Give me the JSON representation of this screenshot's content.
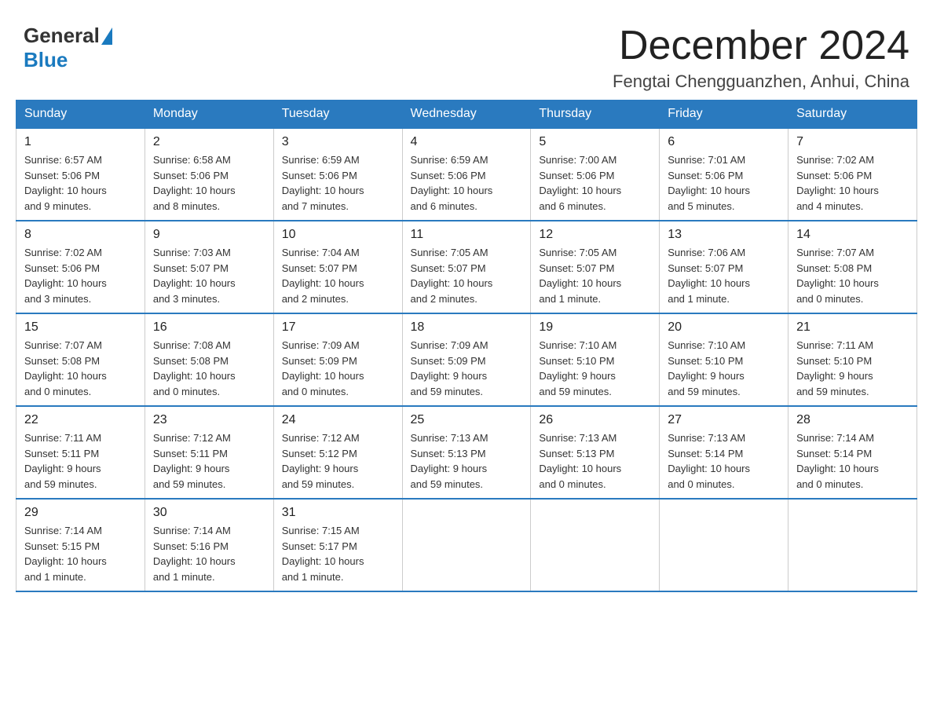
{
  "header": {
    "logo_general": "General",
    "logo_blue": "Blue",
    "month_title": "December 2024",
    "location": "Fengtai Chengguanzhen, Anhui, China"
  },
  "days_of_week": [
    "Sunday",
    "Monday",
    "Tuesday",
    "Wednesday",
    "Thursday",
    "Friday",
    "Saturday"
  ],
  "weeks": [
    [
      {
        "day": "1",
        "info": "Sunrise: 6:57 AM\nSunset: 5:06 PM\nDaylight: 10 hours\nand 9 minutes."
      },
      {
        "day": "2",
        "info": "Sunrise: 6:58 AM\nSunset: 5:06 PM\nDaylight: 10 hours\nand 8 minutes."
      },
      {
        "day": "3",
        "info": "Sunrise: 6:59 AM\nSunset: 5:06 PM\nDaylight: 10 hours\nand 7 minutes."
      },
      {
        "day": "4",
        "info": "Sunrise: 6:59 AM\nSunset: 5:06 PM\nDaylight: 10 hours\nand 6 minutes."
      },
      {
        "day": "5",
        "info": "Sunrise: 7:00 AM\nSunset: 5:06 PM\nDaylight: 10 hours\nand 6 minutes."
      },
      {
        "day": "6",
        "info": "Sunrise: 7:01 AM\nSunset: 5:06 PM\nDaylight: 10 hours\nand 5 minutes."
      },
      {
        "day": "7",
        "info": "Sunrise: 7:02 AM\nSunset: 5:06 PM\nDaylight: 10 hours\nand 4 minutes."
      }
    ],
    [
      {
        "day": "8",
        "info": "Sunrise: 7:02 AM\nSunset: 5:06 PM\nDaylight: 10 hours\nand 3 minutes."
      },
      {
        "day": "9",
        "info": "Sunrise: 7:03 AM\nSunset: 5:07 PM\nDaylight: 10 hours\nand 3 minutes."
      },
      {
        "day": "10",
        "info": "Sunrise: 7:04 AM\nSunset: 5:07 PM\nDaylight: 10 hours\nand 2 minutes."
      },
      {
        "day": "11",
        "info": "Sunrise: 7:05 AM\nSunset: 5:07 PM\nDaylight: 10 hours\nand 2 minutes."
      },
      {
        "day": "12",
        "info": "Sunrise: 7:05 AM\nSunset: 5:07 PM\nDaylight: 10 hours\nand 1 minute."
      },
      {
        "day": "13",
        "info": "Sunrise: 7:06 AM\nSunset: 5:07 PM\nDaylight: 10 hours\nand 1 minute."
      },
      {
        "day": "14",
        "info": "Sunrise: 7:07 AM\nSunset: 5:08 PM\nDaylight: 10 hours\nand 0 minutes."
      }
    ],
    [
      {
        "day": "15",
        "info": "Sunrise: 7:07 AM\nSunset: 5:08 PM\nDaylight: 10 hours\nand 0 minutes."
      },
      {
        "day": "16",
        "info": "Sunrise: 7:08 AM\nSunset: 5:08 PM\nDaylight: 10 hours\nand 0 minutes."
      },
      {
        "day": "17",
        "info": "Sunrise: 7:09 AM\nSunset: 5:09 PM\nDaylight: 10 hours\nand 0 minutes."
      },
      {
        "day": "18",
        "info": "Sunrise: 7:09 AM\nSunset: 5:09 PM\nDaylight: 9 hours\nand 59 minutes."
      },
      {
        "day": "19",
        "info": "Sunrise: 7:10 AM\nSunset: 5:10 PM\nDaylight: 9 hours\nand 59 minutes."
      },
      {
        "day": "20",
        "info": "Sunrise: 7:10 AM\nSunset: 5:10 PM\nDaylight: 9 hours\nand 59 minutes."
      },
      {
        "day": "21",
        "info": "Sunrise: 7:11 AM\nSunset: 5:10 PM\nDaylight: 9 hours\nand 59 minutes."
      }
    ],
    [
      {
        "day": "22",
        "info": "Sunrise: 7:11 AM\nSunset: 5:11 PM\nDaylight: 9 hours\nand 59 minutes."
      },
      {
        "day": "23",
        "info": "Sunrise: 7:12 AM\nSunset: 5:11 PM\nDaylight: 9 hours\nand 59 minutes."
      },
      {
        "day": "24",
        "info": "Sunrise: 7:12 AM\nSunset: 5:12 PM\nDaylight: 9 hours\nand 59 minutes."
      },
      {
        "day": "25",
        "info": "Sunrise: 7:13 AM\nSunset: 5:13 PM\nDaylight: 9 hours\nand 59 minutes."
      },
      {
        "day": "26",
        "info": "Sunrise: 7:13 AM\nSunset: 5:13 PM\nDaylight: 10 hours\nand 0 minutes."
      },
      {
        "day": "27",
        "info": "Sunrise: 7:13 AM\nSunset: 5:14 PM\nDaylight: 10 hours\nand 0 minutes."
      },
      {
        "day": "28",
        "info": "Sunrise: 7:14 AM\nSunset: 5:14 PM\nDaylight: 10 hours\nand 0 minutes."
      }
    ],
    [
      {
        "day": "29",
        "info": "Sunrise: 7:14 AM\nSunset: 5:15 PM\nDaylight: 10 hours\nand 1 minute."
      },
      {
        "day": "30",
        "info": "Sunrise: 7:14 AM\nSunset: 5:16 PM\nDaylight: 10 hours\nand 1 minute."
      },
      {
        "day": "31",
        "info": "Sunrise: 7:15 AM\nSunset: 5:17 PM\nDaylight: 10 hours\nand 1 minute."
      },
      null,
      null,
      null,
      null
    ]
  ]
}
